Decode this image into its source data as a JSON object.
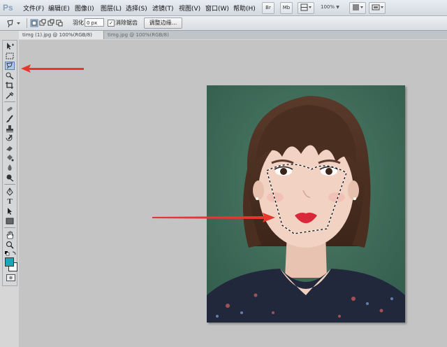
{
  "app": {
    "logo": "Ps"
  },
  "menu": [
    "文件(F)",
    "编辑(E)",
    "图像(I)",
    "图层(L)",
    "选择(S)",
    "滤镜(T)",
    "视图(V)",
    "窗口(W)",
    "帮助(H)"
  ],
  "app_bar": {
    "btn_br": "Br",
    "btn_mb": "Mb",
    "zoom": "100%"
  },
  "options": {
    "feather_label": "羽化:",
    "feather_value": "0 px",
    "antialias_label": "消除锯齿",
    "refine_label": "调整边缘..."
  },
  "tabs": [
    {
      "label": "timg (1).jpg @ 100%(RGB/8)",
      "active": true
    },
    {
      "label": "timg.jpg @ 100%(RGB/8)",
      "active": false
    }
  ],
  "tools": [
    "move-tool",
    "marquee-tool",
    "lasso-tool",
    "quick-select-tool",
    "crop-tool",
    "eyedropper-tool",
    "healing-tool",
    "brush-tool",
    "stamp-tool",
    "history-brush-tool",
    "eraser-tool",
    "gradient-tool",
    "blur-tool",
    "dodge-tool",
    "pen-tool",
    "type-tool",
    "path-select-tool",
    "shape-tool",
    "hand-tool",
    "zoom-tool"
  ],
  "colors": {
    "foreground": "#1ea3b8",
    "background": "#ffffff",
    "annotation_arrow": "#e8362f"
  }
}
